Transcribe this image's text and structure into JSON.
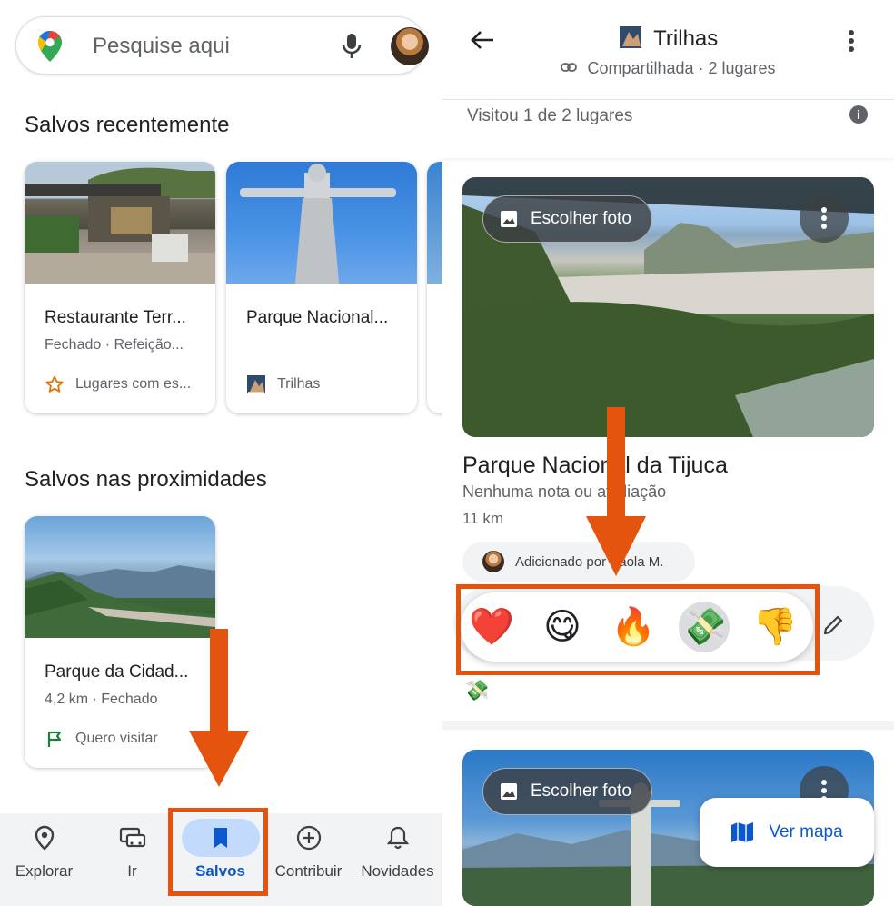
{
  "left": {
    "search": {
      "placeholder": "Pesquise aqui"
    },
    "recent_title": "Salvos recentemente",
    "recent_cards": [
      {
        "name": "Restaurante Terr...",
        "meta": "Fechado · Refeição...",
        "list": "Lugares com es...",
        "list_icon": "star-icon"
      },
      {
        "name": "Parque Nacional...",
        "meta": "",
        "list": "Trilhas",
        "list_icon": "trail-list-icon"
      }
    ],
    "nearby_title": "Salvos nas proximidades",
    "nearby_cards": [
      {
        "name": "Parque da Cidad...",
        "meta": "4,2 km · Fechado",
        "list": "Quero visitar",
        "list_icon": "flag-icon"
      }
    ],
    "nav": [
      {
        "label": "Explorar",
        "icon": "location-pin-icon"
      },
      {
        "label": "Ir",
        "icon": "car-icon"
      },
      {
        "label": "Salvos",
        "icon": "bookmark-icon",
        "active": true
      },
      {
        "label": "Contribuir",
        "icon": "add-circle-icon"
      },
      {
        "label": "Novidades",
        "icon": "bell-icon"
      }
    ]
  },
  "right": {
    "header": {
      "title": "Trilhas",
      "subtitle": "Compartilhada · 2 lugares"
    },
    "visited": "Visitou 1 de 2 lugares",
    "place": {
      "choose_photo": "Escolher foto",
      "name": "Parque Nacional da Tijuca",
      "note": "Nenhuma nota ou avaliação",
      "distance": "11 km",
      "added_by": "Adicionado por Paola M."
    },
    "reactions": [
      "❤️",
      "😋",
      "🔥",
      "💸",
      "👎"
    ],
    "selected_reaction": "💸",
    "place2": {
      "choose_photo": "Escolher foto"
    },
    "map_button": "Ver mapa"
  },
  "colors": {
    "highlight": "#e5540e",
    "accent": "#0b57d0",
    "active_pill": "#c2dbfd"
  }
}
